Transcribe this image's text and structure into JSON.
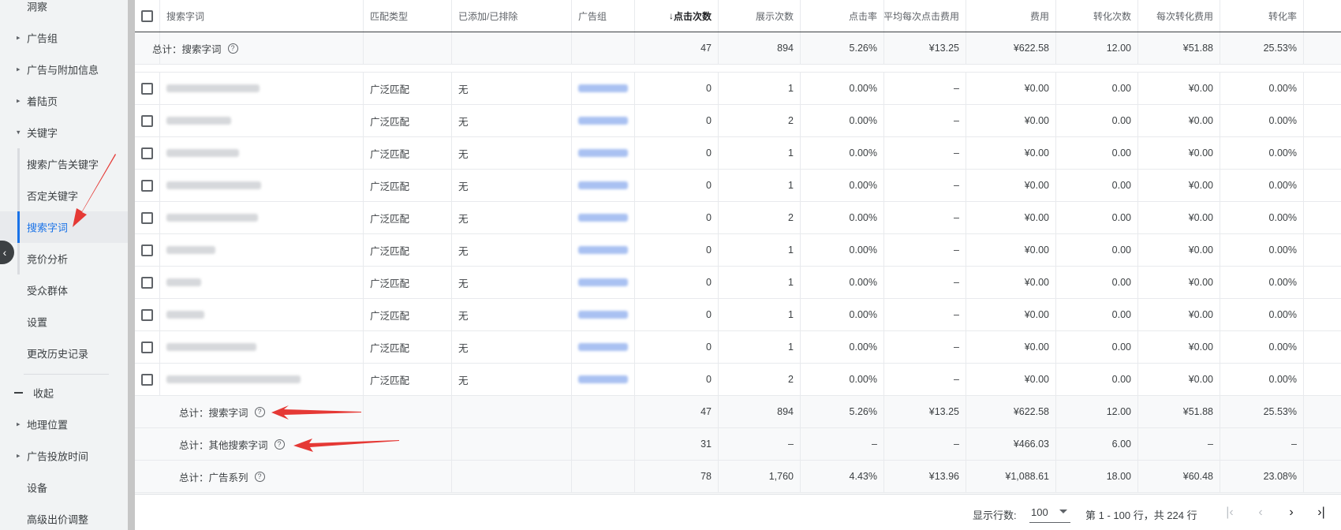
{
  "sidebar": {
    "items": [
      {
        "label": "洞察",
        "caret": false
      },
      {
        "label": "广告组",
        "caret": true
      },
      {
        "label": "广告与附加信息",
        "caret": true
      },
      {
        "label": "着陆页",
        "caret": true
      },
      {
        "label": "关键字",
        "caret": "open"
      },
      {
        "label": "搜索广告关键字",
        "caret": false
      },
      {
        "label": "否定关键字",
        "caret": false
      },
      {
        "label": "搜索字词",
        "caret": false,
        "active": true
      },
      {
        "label": "竞价分析",
        "caret": false
      },
      {
        "label": "受众群体",
        "caret": false
      },
      {
        "label": "设置",
        "caret": false
      },
      {
        "label": "更改历史记录",
        "caret": false
      },
      {
        "label": "收起",
        "caret": false
      },
      {
        "label": "地理位置",
        "caret": true
      },
      {
        "label": "广告投放时间",
        "caret": true
      },
      {
        "label": "设备",
        "caret": false
      },
      {
        "label": "高级出价调整",
        "caret": false
      }
    ],
    "toggle_icon": "chevron-left-icon"
  },
  "table": {
    "headers": {
      "search_term": "搜索字词",
      "match_type": "匹配类型",
      "added_excluded": "已添加/已排除",
      "ad_group": "广告组",
      "clicks": "点击次数",
      "impressions": "展示次数",
      "ctr": "点击率",
      "avg_cpc": "平均每次点击费用",
      "cost": "费用",
      "conversions": "转化次数",
      "cost_per_conv": "每次转化费用",
      "conv_rate": "转化率"
    },
    "top_total": {
      "label": "总计：搜索字词",
      "clicks": "47",
      "impressions": "894",
      "ctr": "5.26%",
      "avg_cpc": "¥13.25",
      "cost": "¥622.58",
      "conversions": "12.00",
      "cost_per_conv": "¥51.88",
      "conv_rate": "25.53%"
    },
    "rows": [
      {
        "match_type": "广泛匹配",
        "added": "无",
        "clicks": "0",
        "impressions": "1",
        "ctr": "0.00%",
        "avg_cpc": "–",
        "cost": "¥0.00",
        "conversions": "0.00",
        "cost_per_conv": "¥0.00",
        "conv_rate": "0.00%"
      },
      {
        "match_type": "广泛匹配",
        "added": "无",
        "clicks": "0",
        "impressions": "2",
        "ctr": "0.00%",
        "avg_cpc": "–",
        "cost": "¥0.00",
        "conversions": "0.00",
        "cost_per_conv": "¥0.00",
        "conv_rate": "0.00%"
      },
      {
        "match_type": "广泛匹配",
        "added": "无",
        "clicks": "0",
        "impressions": "1",
        "ctr": "0.00%",
        "avg_cpc": "–",
        "cost": "¥0.00",
        "conversions": "0.00",
        "cost_per_conv": "¥0.00",
        "conv_rate": "0.00%"
      },
      {
        "match_type": "广泛匹配",
        "added": "无",
        "clicks": "0",
        "impressions": "1",
        "ctr": "0.00%",
        "avg_cpc": "–",
        "cost": "¥0.00",
        "conversions": "0.00",
        "cost_per_conv": "¥0.00",
        "conv_rate": "0.00%"
      },
      {
        "match_type": "广泛匹配",
        "added": "无",
        "clicks": "0",
        "impressions": "2",
        "ctr": "0.00%",
        "avg_cpc": "–",
        "cost": "¥0.00",
        "conversions": "0.00",
        "cost_per_conv": "¥0.00",
        "conv_rate": "0.00%"
      },
      {
        "match_type": "广泛匹配",
        "added": "无",
        "clicks": "0",
        "impressions": "1",
        "ctr": "0.00%",
        "avg_cpc": "–",
        "cost": "¥0.00",
        "conversions": "0.00",
        "cost_per_conv": "¥0.00",
        "conv_rate": "0.00%"
      },
      {
        "match_type": "广泛匹配",
        "added": "无",
        "clicks": "0",
        "impressions": "1",
        "ctr": "0.00%",
        "avg_cpc": "–",
        "cost": "¥0.00",
        "conversions": "0.00",
        "cost_per_conv": "¥0.00",
        "conv_rate": "0.00%"
      },
      {
        "match_type": "广泛匹配",
        "added": "无",
        "clicks": "0",
        "impressions": "1",
        "ctr": "0.00%",
        "avg_cpc": "–",
        "cost": "¥0.00",
        "conversions": "0.00",
        "cost_per_conv": "¥0.00",
        "conv_rate": "0.00%"
      },
      {
        "match_type": "广泛匹配",
        "added": "无",
        "clicks": "0",
        "impressions": "1",
        "ctr": "0.00%",
        "avg_cpc": "–",
        "cost": "¥0.00",
        "conversions": "0.00",
        "cost_per_conv": "¥0.00",
        "conv_rate": "0.00%"
      },
      {
        "match_type": "广泛匹配",
        "added": "无",
        "clicks": "0",
        "impressions": "2",
        "ctr": "0.00%",
        "avg_cpc": "–",
        "cost": "¥0.00",
        "conversions": "0.00",
        "cost_per_conv": "¥0.00",
        "conv_rate": "0.00%"
      }
    ],
    "totals": [
      {
        "label": "总计：搜索字词",
        "clicks": "47",
        "impressions": "894",
        "ctr": "5.26%",
        "avg_cpc": "¥13.25",
        "cost": "¥622.58",
        "conversions": "12.00",
        "cost_per_conv": "¥51.88",
        "conv_rate": "25.53%"
      },
      {
        "label": "总计：其他搜索字词",
        "clicks": "31",
        "impressions": "–",
        "ctr": "–",
        "avg_cpc": "–",
        "cost": "¥466.03",
        "conversions": "6.00",
        "cost_per_conv": "–",
        "conv_rate": "–"
      },
      {
        "label": "总计：广告系列",
        "clicks": "78",
        "impressions": "1,760",
        "ctr": "4.43%",
        "avg_cpc": "¥13.96",
        "cost": "¥1,088.61",
        "conversions": "18.00",
        "cost_per_conv": "¥60.48",
        "conv_rate": "23.08%"
      }
    ]
  },
  "footer": {
    "rows_label": "显示行数:",
    "rows_value": "100",
    "range_text": "第 1 - 100 行，共 224 行"
  },
  "colors": {
    "accent": "#1a73e8",
    "annotation_arrow": "#e53935"
  }
}
